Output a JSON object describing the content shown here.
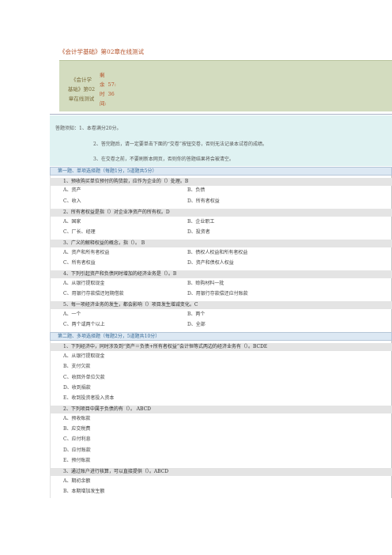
{
  "title": "《会计学基础》第02章在线测试",
  "header": {
    "name_lines": [
      "《会计学",
      "基础》第02",
      "章在线测试"
    ],
    "remain_lines": [
      "剩",
      "余",
      "时",
      "间:"
    ],
    "time_lines": [
      "",
      "57:",
      "36",
      ""
    ]
  },
  "notice": {
    "line1": "答题须知：1、本卷满分20分。",
    "line2": "2、答完题后，请一定要单击下面的“交卷”按钮交卷，否则无法记录本试卷的成绩。",
    "line3": "3、在交卷之前，不要刷新本网页，否则你的答题结果将会被清空。"
  },
  "sections": [
    {
      "heading": "第一题、单项选择题（每题1分，5道题共5分）",
      "questions": [
        {
          "text": "1、预收购买单位预付的购货款，应作为企业的（）处理。B",
          "options": [
            "A、资产",
            "B、负债",
            "C、收入",
            "D、所有者权益"
          ]
        },
        {
          "text": "2、所有者权益是指（）对企业净资产的所有权。D",
          "options": [
            "A、国家",
            "B、企业职工",
            "C、厂长、经理",
            "D、投资者"
          ]
        },
        {
          "text": "3、广义的解释权益的概念，指（）。    B",
          "options": [
            "A、资产和所有者权益",
            "B、债权人权益和所有者权益",
            "C、所有者权益",
            "D、资产和债权人权益"
          ]
        },
        {
          "text": "4、下列引起资产和负债同时增加的经济业务是（）。B",
          "options": [
            "A、从银行提取现金",
            "B、赊购材料一批",
            "C、用银行存款偿还短期借款",
            "D、用银行存款偿还应付账款"
          ]
        },
        {
          "text": "5、每一项经济业务的发生，都会影响（）项目发生增减变化。C",
          "options": [
            "A、一个",
            "B、两个",
            "C、两个或两个以上",
            "D、全部"
          ]
        }
      ]
    },
    {
      "heading": "第二题、多项选择题（每题2分，5道题共10分）",
      "questions": [
        {
          "text": "1、下列经济中，同时涉及到“资产＝负债+所有者权益”会计恒等式两边的经济业务有（）。BCDE",
          "options": [
            "A、从银行提取现金",
            "B、支付欠款",
            "C、收回外单位欠款",
            "D、收到捐款",
            "E、收到投资者投入资本"
          ]
        },
        {
          "text": "2、下列项目中属于负债的有（）。    ABCD",
          "options": [
            "A、预收账款",
            "B、应交税费",
            "C、应付利息",
            "D、应付账款",
            "E、预付账款"
          ]
        },
        {
          "text": "3、通过账户进行核算，可以直接提供（）。ABCD",
          "options": [
            "A、期初余额",
            "B、本期增加发生额"
          ]
        }
      ]
    }
  ]
}
